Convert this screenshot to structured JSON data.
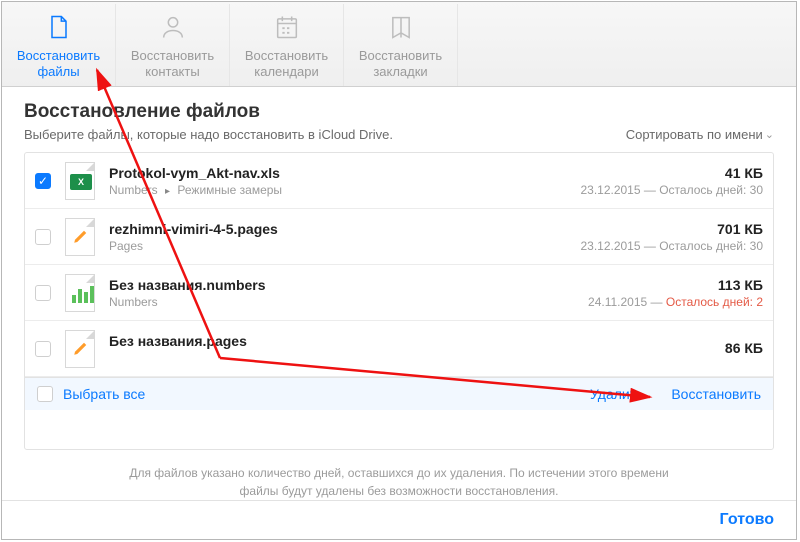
{
  "toolbar": {
    "files": {
      "line1": "Восстановить",
      "line2": "файлы"
    },
    "contacts": {
      "line1": "Восстановить",
      "line2": "контакты"
    },
    "calendars": {
      "line1": "Восстановить",
      "line2": "календари"
    },
    "bookmarks": {
      "line1": "Восстановить",
      "line2": "закладки"
    }
  },
  "header": {
    "title": "Восстановление файлов",
    "subtitle": "Выберите файлы, которые надо восстановить в iCloud Drive.",
    "sort_label": "Сортировать по имени"
  },
  "files": [
    {
      "checked": true,
      "icon": "excel",
      "name": "Protokol-vym_Akt-nav.xls",
      "path_app": "Numbers",
      "path_sep": "▸",
      "path_folder": "Режимные замеры",
      "size": "41 КБ",
      "date": "23.12.2015",
      "sep": " — ",
      "remaining": "Осталось дней: 30",
      "warn": false
    },
    {
      "checked": false,
      "icon": "pages",
      "name": "rezhimni-vimiri-4-5.pages",
      "path_app": "Pages",
      "path_sep": "",
      "path_folder": "",
      "size": "701 КБ",
      "date": "23.12.2015",
      "sep": " — ",
      "remaining": "Осталось дней: 30",
      "warn": false
    },
    {
      "checked": false,
      "icon": "numbers",
      "name": "Без названия.numbers",
      "path_app": "Numbers",
      "path_sep": "",
      "path_folder": "",
      "size": "113 КБ",
      "date": "24.11.2015",
      "sep": " — ",
      "remaining": "Осталось дней: 2",
      "warn": true
    },
    {
      "checked": false,
      "icon": "pages",
      "name": "Без названия.pages",
      "path_app": "",
      "path_sep": "",
      "path_folder": "",
      "size": "86 КБ",
      "date": "",
      "sep": "",
      "remaining": "",
      "warn": false
    }
  ],
  "list_footer": {
    "select_all": "Выбрать все",
    "delete": "Удалить",
    "restore": "Восстановить"
  },
  "note": "Для файлов указано количество дней, оставшихся до их удаления. По истечении этого времени файлы будут удалены без возможности восстановления.",
  "bottom": {
    "done": "Готово"
  }
}
